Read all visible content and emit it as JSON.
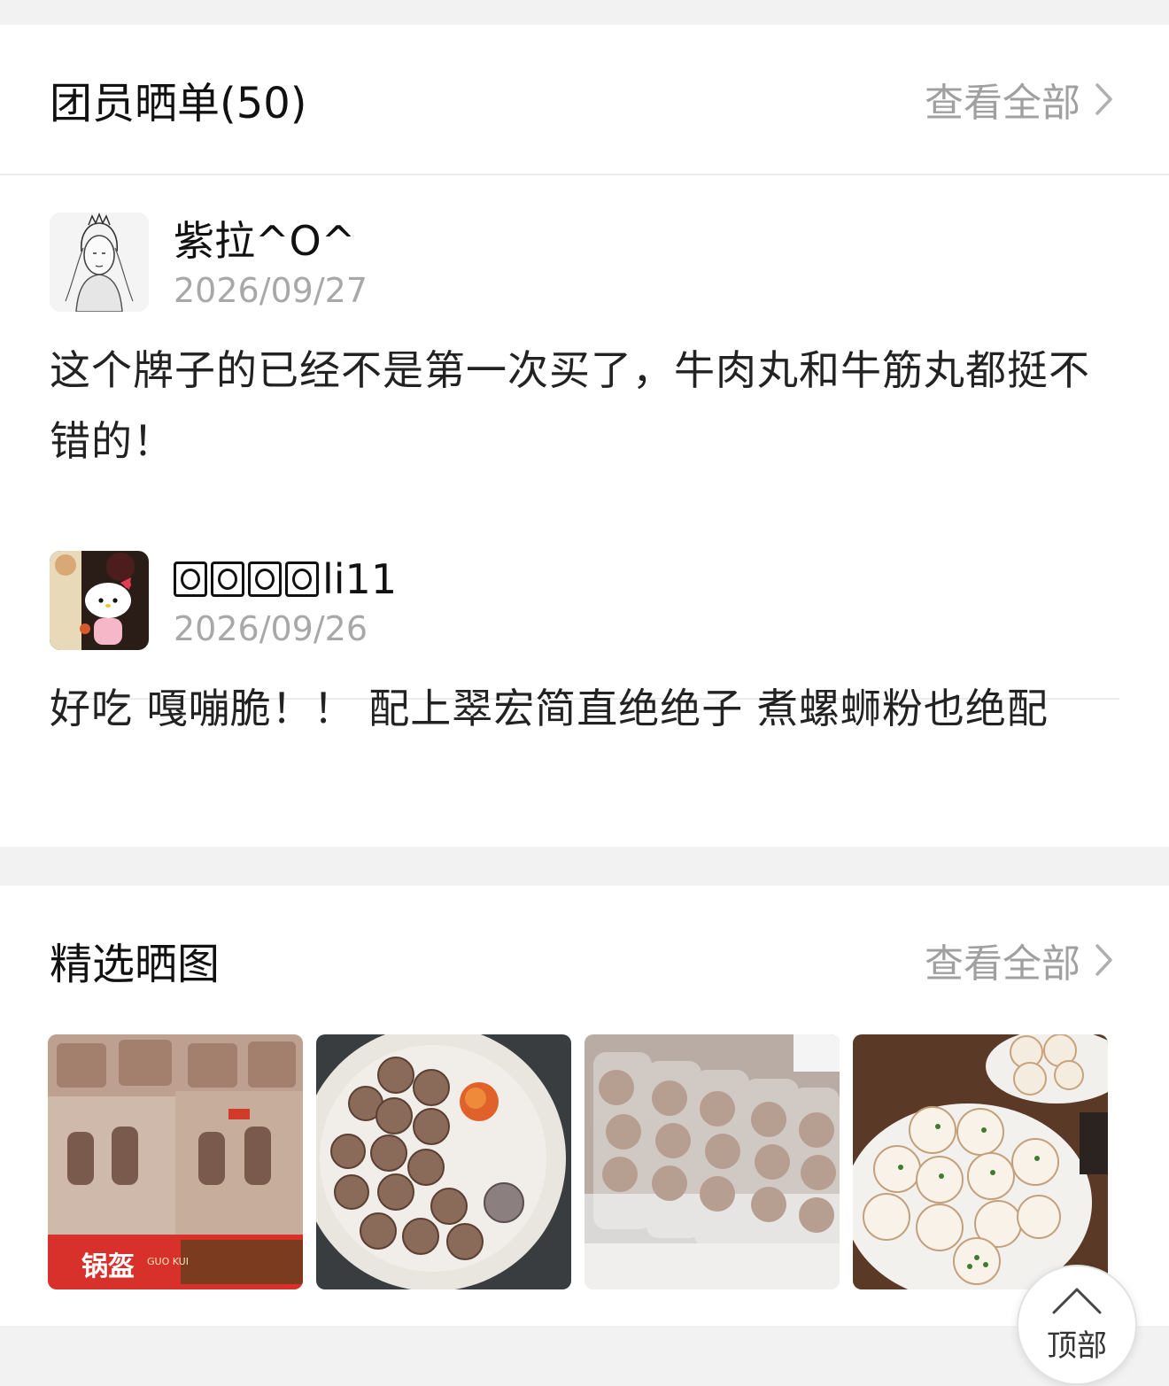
{
  "reviews_section": {
    "title": "团员晒单(50)",
    "view_all": "查看全部",
    "reviews": [
      {
        "username": "紫拉^O^",
        "date": "2026/09/27",
        "text": "这个牌子的已经不是第一次买了，牛肉丸和牛筋丸都挺不错的！"
      },
      {
        "username_suffix": "li11",
        "date": "2026/09/26",
        "text": "好吃 嘎嘣脆！！ 配上翠宏简直绝绝子 煮螺蛳粉也绝配"
      }
    ]
  },
  "photos_section": {
    "title": "精选晒图",
    "view_all": "查看全部",
    "photos": [
      {
        "icon": "packaged-beef-balls-photo",
        "packaging_text": "锅盔",
        "packaging_subtext": "GUO KUI"
      },
      {
        "icon": "fried-meatballs-plate-photo"
      },
      {
        "icon": "frozen-meatball-bags-photo"
      },
      {
        "icon": "pan-fried-buns-photo"
      }
    ]
  },
  "back_to_top": {
    "label": "顶部"
  },
  "colors": {
    "background": "#f2f2f2",
    "card": "#ffffff",
    "muted_text": "#a0a0a0",
    "primary_text": "#111111"
  }
}
